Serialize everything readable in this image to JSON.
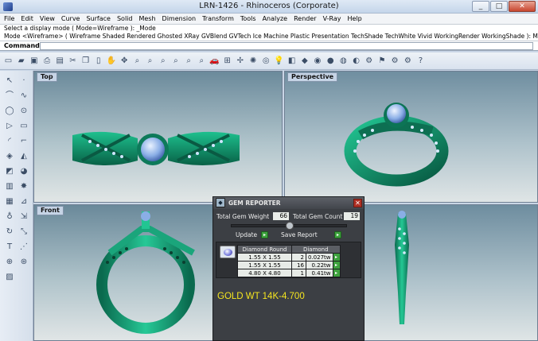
{
  "window": {
    "title": "LRN-1426 - Rhinoceros (Corporate)",
    "minimize": "_",
    "maximize": "□",
    "close": "✕"
  },
  "menu": [
    "File",
    "Edit",
    "View",
    "Curve",
    "Surface",
    "Solid",
    "Mesh",
    "Dimension",
    "Transform",
    "Tools",
    "Analyze",
    "Render",
    "V-Ray",
    "Help"
  ],
  "command_history": [
    "Select a display mode ( Mode=Wireframe ): _Mode",
    "Mode <Wireframe> ( Wireframe  Shaded  Rendered  Ghosted  XRay  GVBlend  GVTech  Ice  Machine  Plastic  Presentation  TechShade  TechWhite  Vivid  WorkingRender  WorkingShade ): M"
  ],
  "command": {
    "label": "Command:",
    "value": ""
  },
  "toolbar_icons": [
    "new-icon",
    "open-icon",
    "save-icon",
    "print-icon",
    "properties-icon",
    "cut-icon",
    "copy-icon",
    "paste-icon",
    "pan-icon",
    "rotate-view-icon",
    "zoom-icon",
    "zoom-window-icon",
    "zoom-extents-icon",
    "zoom-selected-icon",
    "zoom-target-icon",
    "zoom-all-icon",
    "car-icon",
    "grid-icon",
    "point-icon",
    "light-icon",
    "camera-icon",
    "lightbulb-icon",
    "cube-icon",
    "material-icon",
    "color-wheel-icon",
    "sphere-icon",
    "ball-icon",
    "render-icon",
    "settings-icon",
    "pin-icon",
    "gear-icon",
    "cog-icon",
    "help-icon"
  ],
  "viewports": {
    "top": "Top",
    "perspective": "Perspective",
    "front": "Front",
    "right": ""
  },
  "gem_reporter": {
    "title": "GEM REPORTER",
    "close": "✕",
    "total_weight_label": "Total Gem Weight",
    "total_weight": "66",
    "total_count_label": "Total Gem Count",
    "total_count": "19",
    "update_label": "Update",
    "save_label": "Save Report",
    "go_glyph": "▸",
    "header_shape": "Diamond Round",
    "header_type": "Diamond",
    "rows": [
      {
        "size": "1.55 X 1.55",
        "count": "2",
        "weight": "0.027tw"
      },
      {
        "size": "1.55 X 1.55",
        "count": "16",
        "weight": "0.22tw"
      },
      {
        "size": "4.80 X 4.80",
        "count": "1",
        "weight": "0.41tw"
      }
    ]
  },
  "annotation": "GOLD WT 14K-4.700",
  "colors": {
    "metal": "#13a07a",
    "metal_dark": "#0b5c47",
    "gem": "#8aaee6",
    "accent_gold_text": "#f6e61f"
  }
}
